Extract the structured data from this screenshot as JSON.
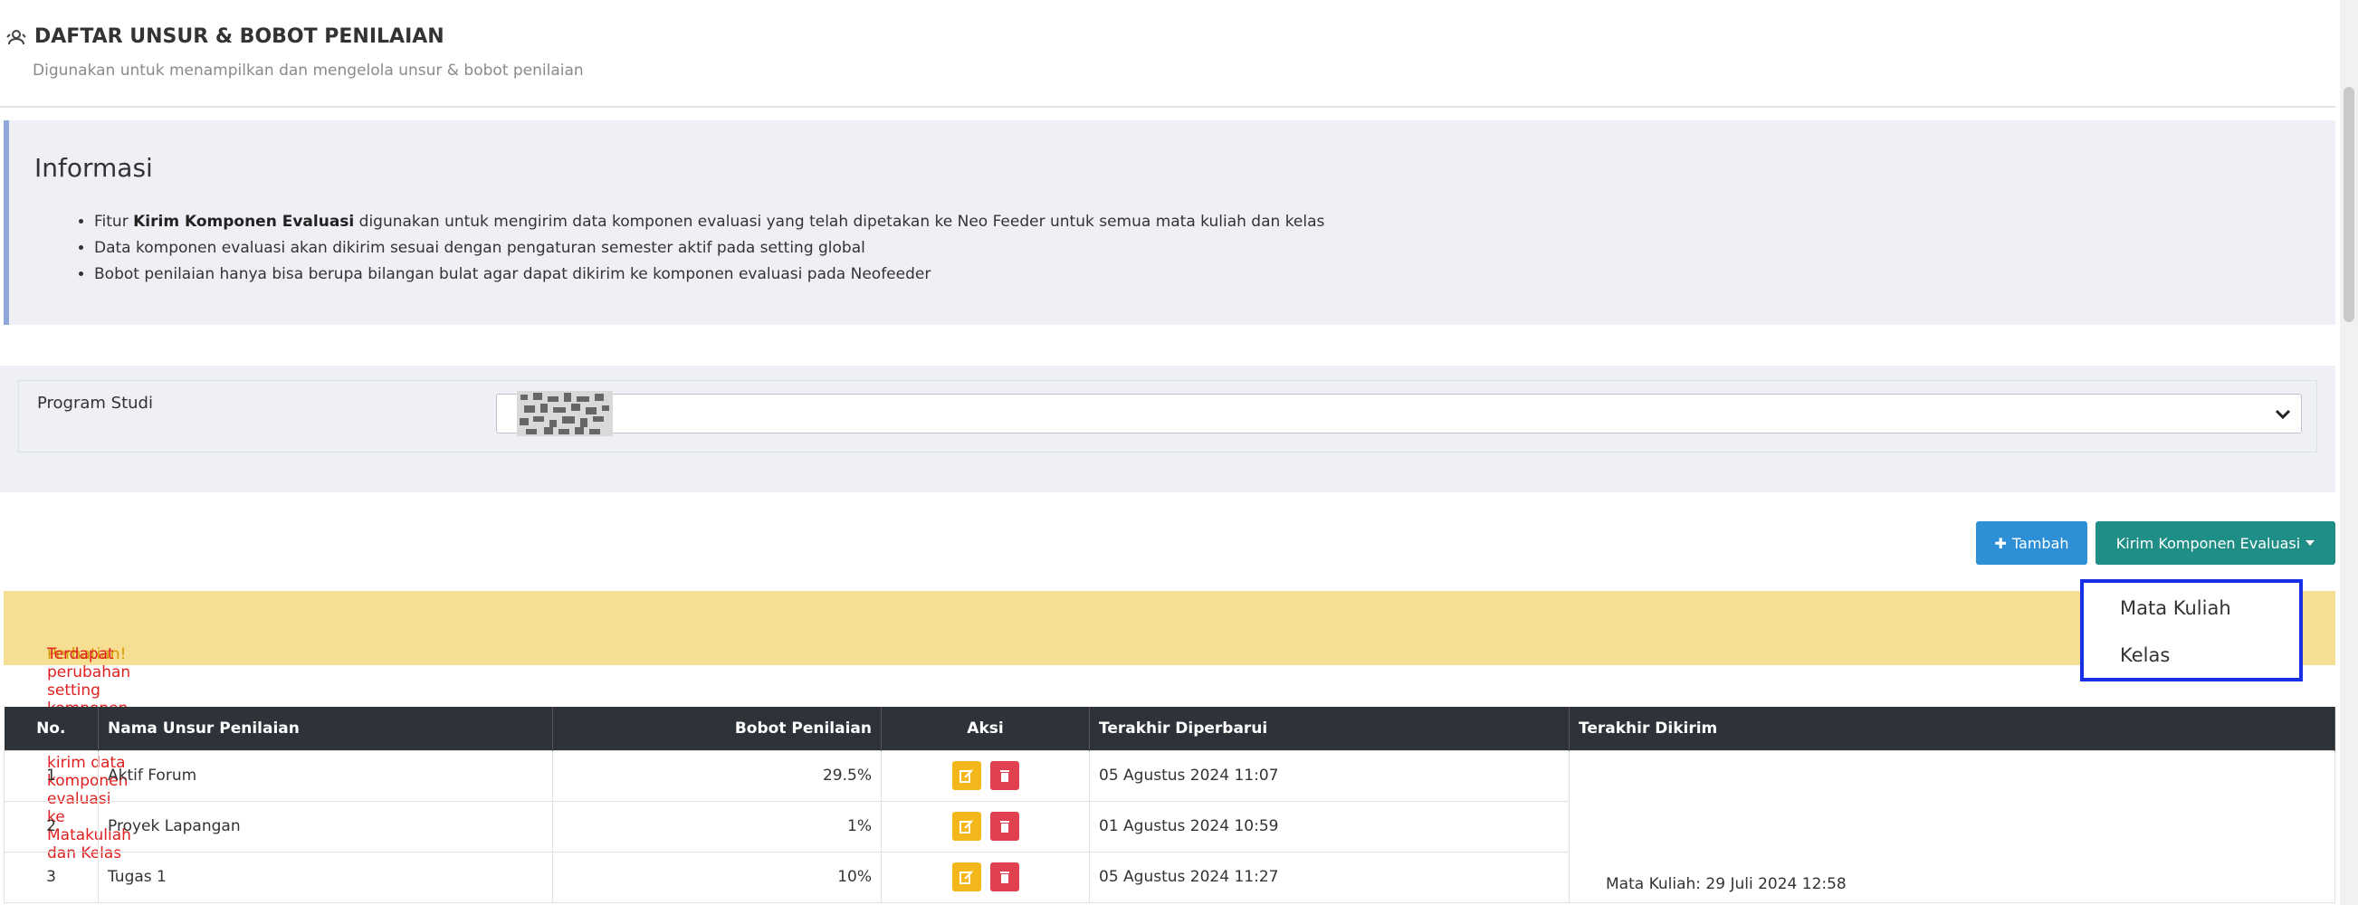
{
  "header": {
    "title": "DAFTAR UNSUR & BOBOT PENILAIAN",
    "subtitle": "Digunakan untuk menampilkan dan mengelola unsur & bobot penilaian",
    "icon": "user-group-icon"
  },
  "info": {
    "title": "Informasi",
    "items": [
      {
        "prefix": "Fitur ",
        "bold": "Kirim Komponen Evaluasi",
        "suffix": " digunakan untuk mengirim data komponen evaluasi yang telah dipetakan ke Neo Feeder untuk semua mata kuliah dan kelas"
      },
      {
        "text": "Data komponen evaluasi akan dikirim sesuai dengan pengaturan semester aktif pada setting global"
      },
      {
        "text": "Bobot penilaian hanya bisa berupa bilangan bulat agar dapat dikirim ke komponen evaluasi pada Neofeeder"
      }
    ]
  },
  "filter": {
    "label": "Program Studi",
    "selected_icon": "redacted-image"
  },
  "toolbar": {
    "tambah_label": "Tambah",
    "kirim_label": "Kirim Komponen Evaluasi"
  },
  "dropdown": {
    "items": [
      "Mata Kuliah",
      "Kelas"
    ]
  },
  "alert": {
    "warning": "Perhatian!",
    "message": " Terdapat perubahan setting komponen evaluasi, Silakan kirim data komponen evaluasi ke Matakuliah dan Kelas"
  },
  "table": {
    "headers": [
      "No.",
      "Nama Unsur Penilaian",
      "Bobot Penilaian",
      "Aksi",
      "Terakhir Diperbarui",
      "Terakhir Dikirim"
    ],
    "rows": [
      {
        "no": "1",
        "name": "Aktif Forum",
        "bobot": "29.5%",
        "updated": "05 Agustus 2024 11:07"
      },
      {
        "no": "2",
        "name": "Proyek Lapangan",
        "bobot": "1%",
        "updated": "01 Agustus 2024 10:59"
      },
      {
        "no": "3",
        "name": "Tugas 1",
        "bobot": "10%",
        "updated": "05 Agustus 2024 11:27"
      }
    ],
    "sent": "Mata Kuliah: 29 Juli 2024 12:58"
  },
  "colors": {
    "primary": "#2d8fd6",
    "teal": "#1f8e86",
    "alert_bg": "#f6df93",
    "alert_text": "#e02020",
    "highlight_border": "#1730e6"
  }
}
